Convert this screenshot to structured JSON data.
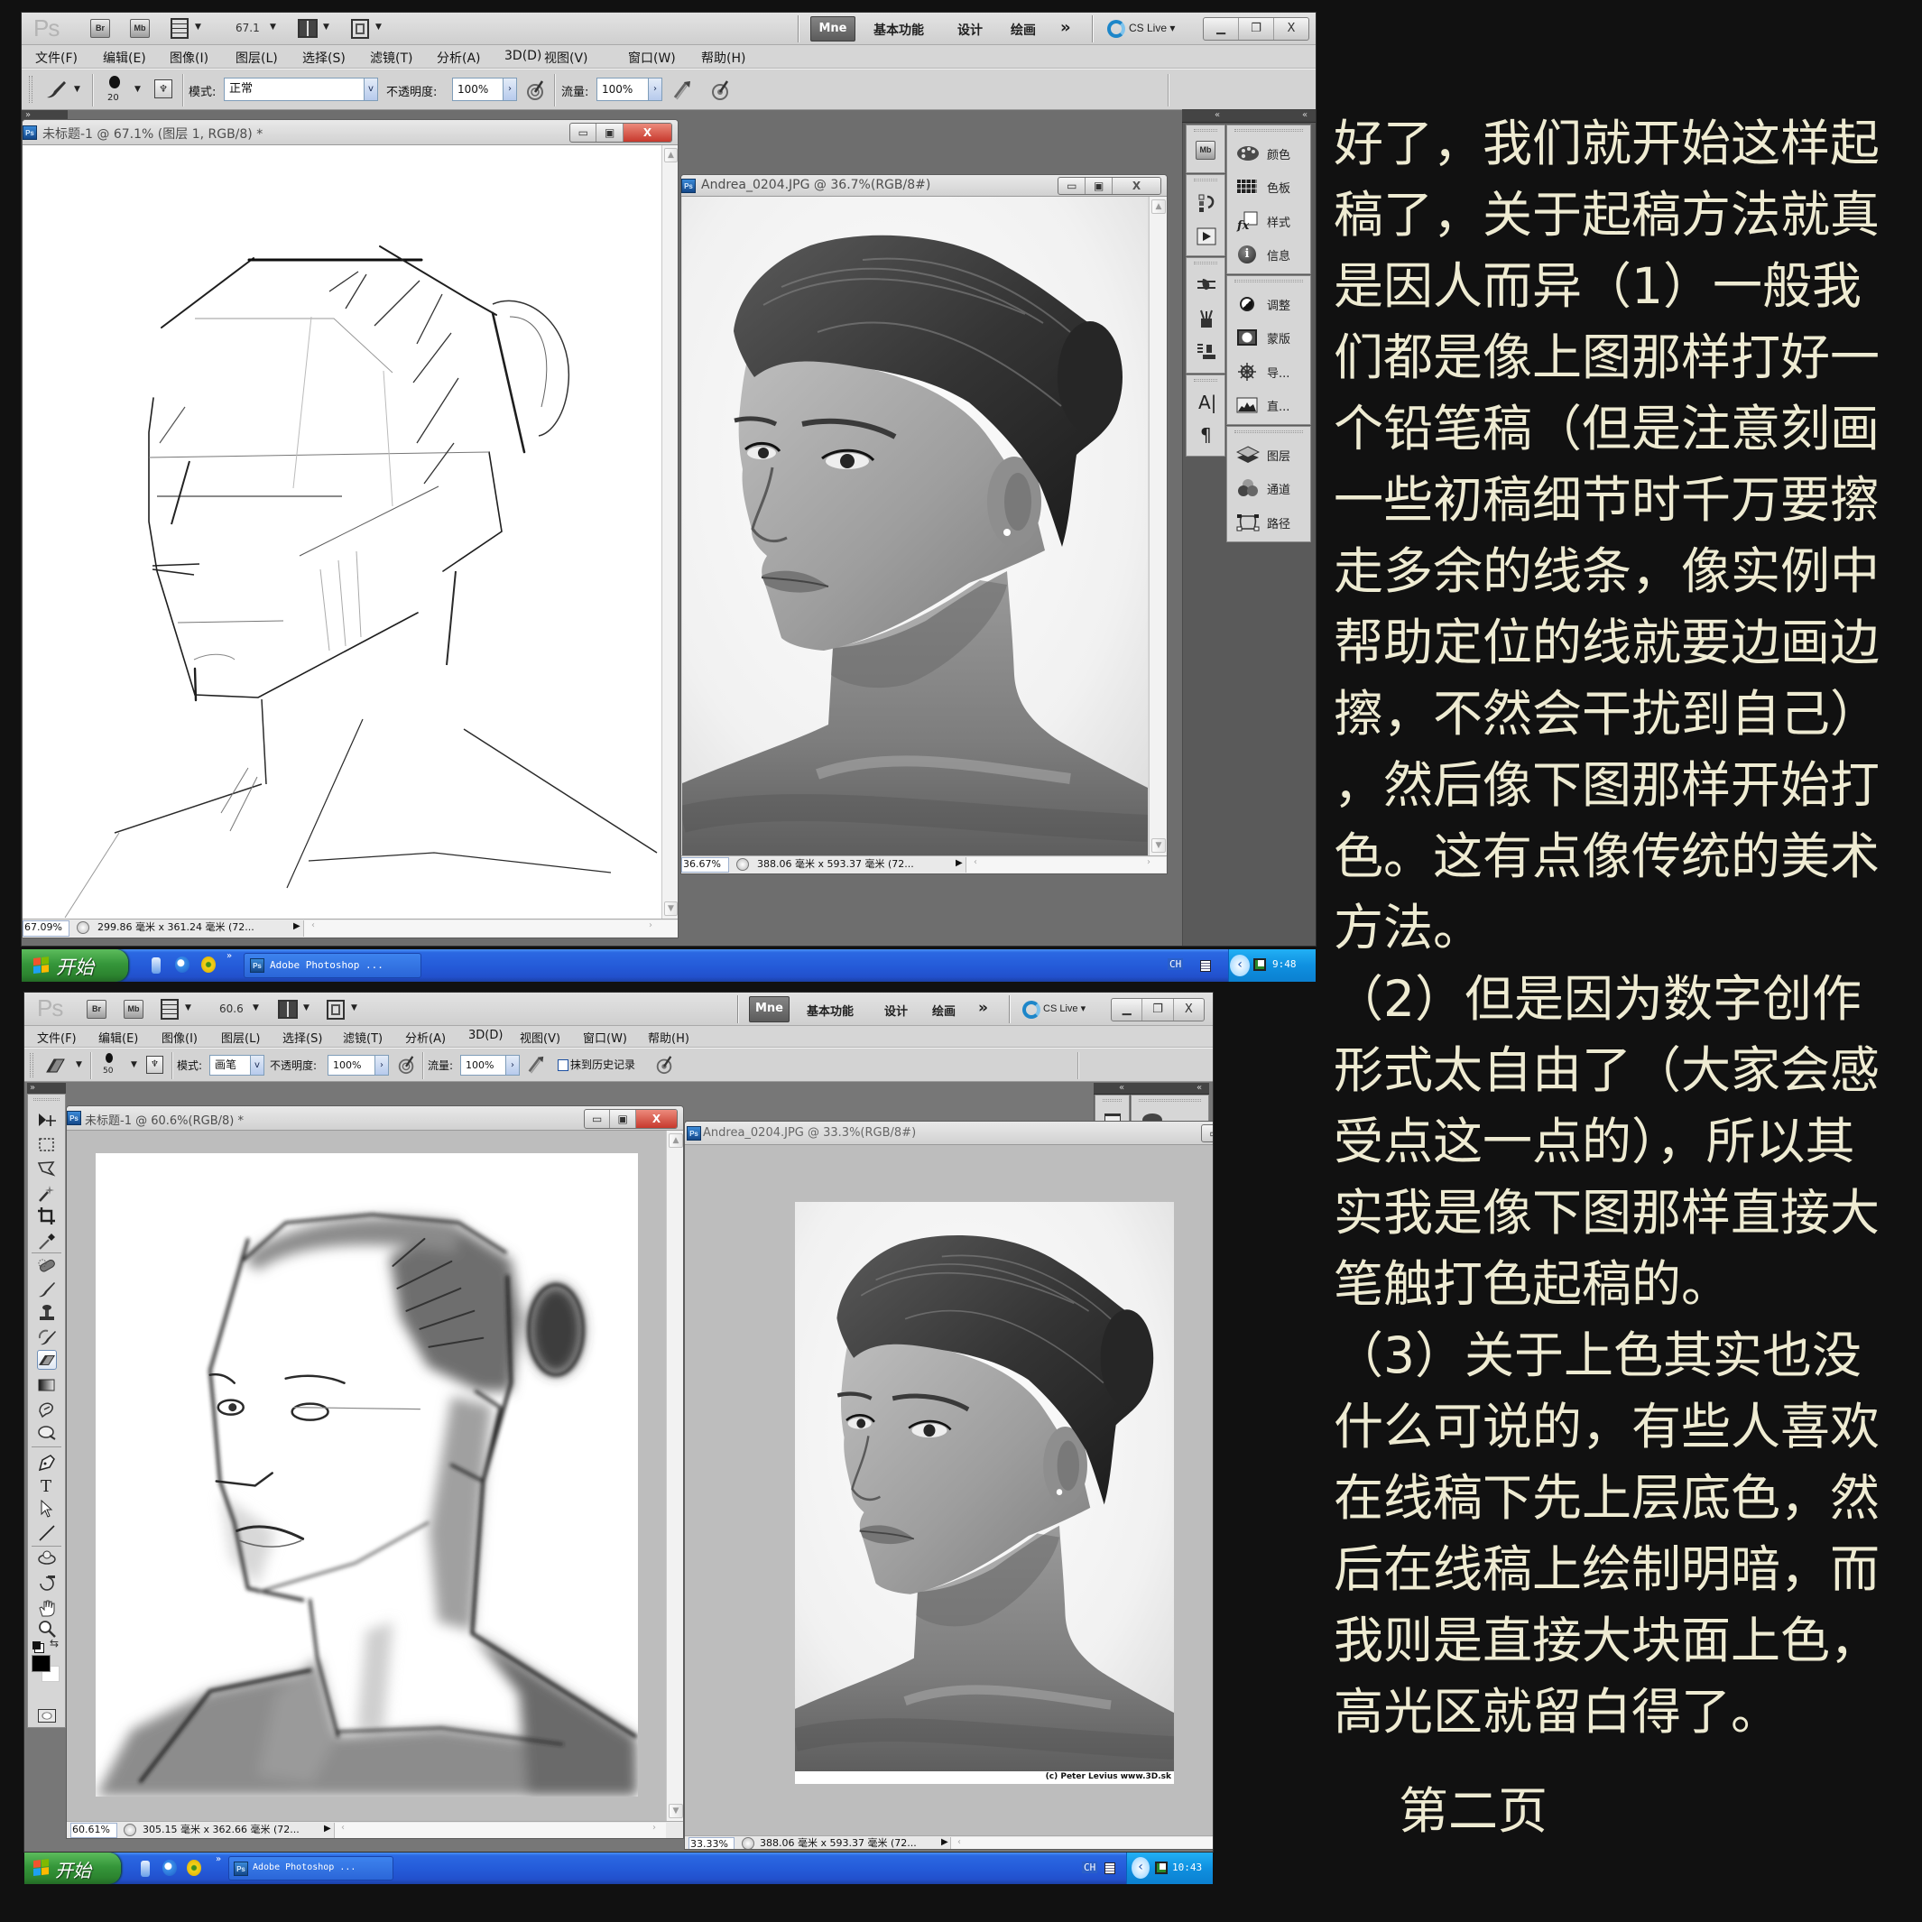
{
  "colors": {
    "page_background": "#111111",
    "article_text": "#eeebd2",
    "taskbar_blue": "#245ad8",
    "start_button_green": "#35963a",
    "close_button_red": "#c7392d",
    "workspace_button_dark": "#6b6b6b",
    "photoshop_blue": "#1d5fa8"
  },
  "top": {
    "app_bar": {
      "logo": "Ps",
      "bridge": "Br",
      "mini_bridge": "Mb",
      "zoom_value": "67.1",
      "workspace_active": "Mne",
      "workspace_1": "基本功能",
      "workspace_2": "设计",
      "workspace_3": "绘画",
      "more": "»",
      "cs_live": "CS Live"
    },
    "menu": [
      "文件(F)",
      "编辑(E)",
      "图像(I)",
      "图层(L)",
      "选择(S)",
      "滤镜(T)",
      "分析(A)",
      "3D(D)",
      "视图(V)",
      "窗口(W)",
      "帮助(H)"
    ],
    "options": {
      "active_tool": "brush",
      "brush_size": "20",
      "mode_label": "模式:",
      "mode_value": "正常",
      "opacity_label": "不透明度:",
      "opacity_value": "100%",
      "flow_label": "流量:",
      "flow_value": "100%"
    },
    "doc_sketch": {
      "title": "未标题-1 @ 67.1% (图层 1, RGB/8) *",
      "zoom": "67.09%",
      "info": "299.86 毫米 x 361.24 毫米 (72..."
    },
    "doc_photo": {
      "title": "Andrea_0204.JPG @ 36.7%(RGB/8#)",
      "zoom": "36.67%",
      "info": "388.06 毫米 x 593.37 毫米 (72..."
    },
    "panels": {
      "color": "颜色",
      "swatches": "色板",
      "styles": "样式",
      "info": "信息",
      "adjustments": "调整",
      "masks": "蒙版",
      "navigator": "导...",
      "histogram": "直...",
      "layers": "图层",
      "channels": "通道",
      "paths": "路径"
    },
    "taskbar": {
      "start": "开始",
      "quick_launch_more": "»",
      "task": "Adobe Photoshop ...",
      "language": "CH",
      "clock": "9:48"
    }
  },
  "bottom": {
    "app_bar": {
      "logo": "Ps",
      "bridge": "Br",
      "mini_bridge": "Mb",
      "zoom_value": "60.6",
      "workspace_active": "Mne",
      "workspace_1": "基本功能",
      "workspace_2": "设计",
      "workspace_3": "绘画",
      "more": "»",
      "cs_live": "CS Live"
    },
    "menu": [
      "文件(F)",
      "编辑(E)",
      "图像(I)",
      "图层(L)",
      "选择(S)",
      "滤镜(T)",
      "分析(A)",
      "3D(D)",
      "视图(V)",
      "窗口(W)",
      "帮助(H)"
    ],
    "options": {
      "active_tool": "eraser",
      "brush_size": "50",
      "mode_label": "模式:",
      "mode_value": "画笔",
      "opacity_label": "不透明度:",
      "opacity_value": "100%",
      "flow_label": "流量:",
      "flow_value": "100%",
      "erase_to_history_label": "抹到历史记录",
      "erase_to_history_checked": false
    },
    "doc_sketch": {
      "title": "未标题-1 @ 60.6%(RGB/8) *",
      "zoom": "60.61%",
      "info": "305.15 毫米 x 362.66 毫米 (72..."
    },
    "doc_photo": {
      "title": "Andrea_0204.JPG @ 33.3%(RGB/8#)",
      "zoom": "33.33%",
      "info": "388.06 毫米 x 593.37 毫米 (72...",
      "credit": "(c) Peter Levius www.3D.sk"
    },
    "taskbar": {
      "start": "开始",
      "quick_launch_more": "»",
      "task": "Adobe Photoshop ...",
      "language": "CH",
      "clock": "10:43"
    }
  },
  "article": {
    "lines": [
      "好了，我们就开始这样起",
      "稿了，关于起稿方法就真",
      "是因人而异（1）一般我",
      "们都是像上图那样打好一",
      "个铅笔稿（但是注意刻画",
      "一些初稿细节时千万要擦",
      "走多余的线条，像实例中",
      "帮助定位的线就要边画边",
      "擦，不然会干扰到自己）",
      "，然后像下图那样开始打",
      "色。这有点像传统的美术",
      "方法。",
      "（2）但是因为数字创作",
      "形式太自由了（大家会感",
      "受点这一点的），所以其",
      "实我是像下图那样直接大",
      "笔触打色起稿的。",
      "（3）关于上色其实也没",
      "什么可说的，有些人喜欢",
      "在线稿下先上层底色，然",
      "后在线稿上绘制明暗，而",
      "我则是直接大块面上色，",
      "高光区就留白得了。"
    ],
    "page_label": "第二页"
  }
}
